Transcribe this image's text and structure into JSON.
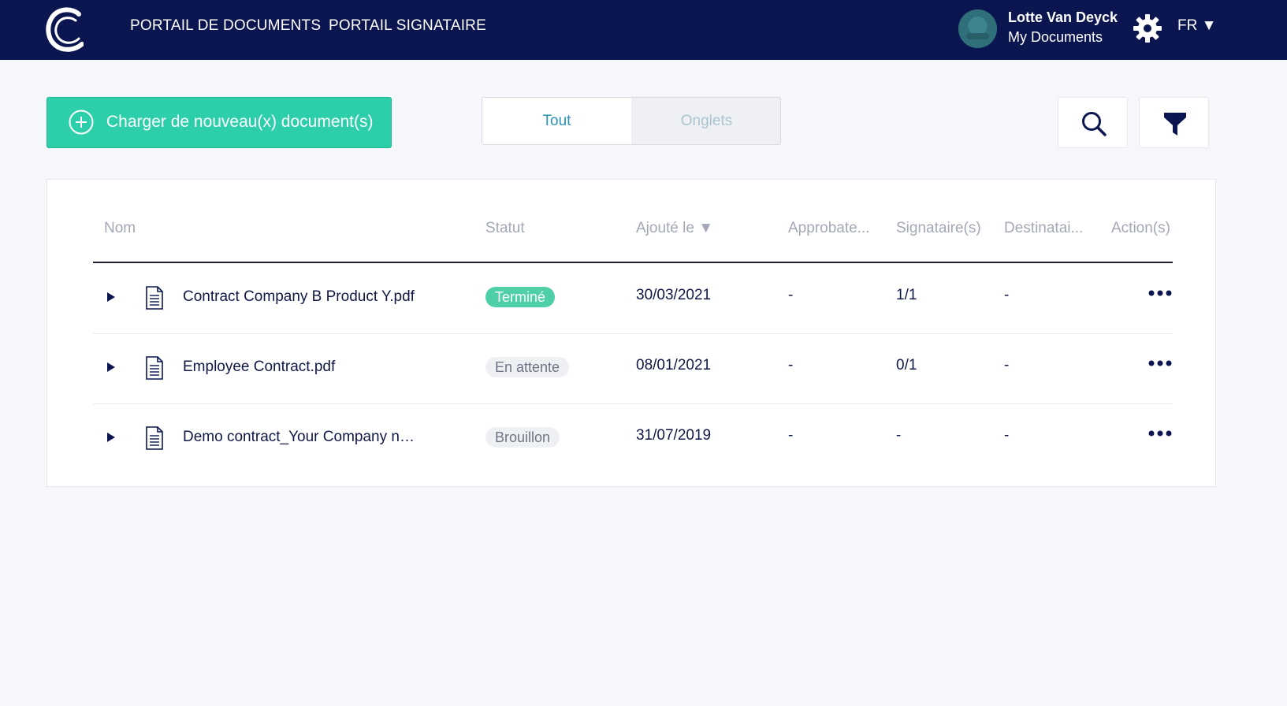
{
  "header": {
    "nav": [
      "PORTAIL DE DOCUMENTS",
      "PORTAIL SIGNATAIRE"
    ],
    "user": {
      "name": "Lotte Van Deyck",
      "subtitle": "My Documents"
    },
    "language": "FR ▼"
  },
  "toolbar": {
    "upload_label": "Charger de nouveau(x) document(s)",
    "toggle": [
      "Tout",
      "Onglets"
    ],
    "toggle_selected": "Tout"
  },
  "table": {
    "columns": [
      "Nom",
      "Statut",
      "Ajouté le ▼",
      "Approbate...",
      "Signataire(s)",
      "Destinatai...",
      "Action(s)"
    ],
    "rows": [
      {
        "name": "Contract Company B Product Y.pdf",
        "status": "Terminé",
        "status_kind": "done",
        "date": "30/03/2021",
        "approvers": "-",
        "signers": "1/1",
        "recipients": "-"
      },
      {
        "name": "Employee Contract.pdf",
        "status": "En attente",
        "status_kind": "wait",
        "date": "08/01/2021",
        "approvers": "-",
        "signers": "0/1",
        "recipients": "-"
      },
      {
        "name": "Demo contract_Your Company na...",
        "status": "Brouillon",
        "status_kind": "draft",
        "date": "31/07/2019",
        "approvers": "-",
        "signers": "-",
        "recipients": "-"
      }
    ]
  },
  "colors": {
    "header_bg": "#0b1650",
    "accent_green": "#2ccfa9",
    "toggle_active": "#2a93b5",
    "page_bg": "#f6f7fa"
  },
  "icons": [
    "logo-c",
    "avatar",
    "gear-icon",
    "plus-circle-icon",
    "search-icon",
    "filter-icon",
    "expand-arrow-icon",
    "document-icon",
    "more-dots-icon"
  ]
}
